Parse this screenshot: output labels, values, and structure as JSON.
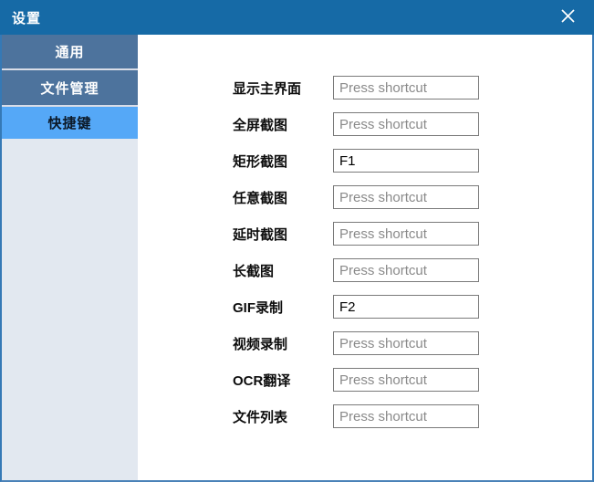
{
  "window": {
    "title": "设置",
    "close_icon": "x-close"
  },
  "sidebar": {
    "tabs": [
      {
        "label": "通用",
        "selected": false
      },
      {
        "label": "文件管理",
        "selected": false
      },
      {
        "label": "快捷键",
        "selected": true
      }
    ]
  },
  "shortcuts": {
    "placeholder": "Press shortcut",
    "rows": [
      {
        "label": "显示主界面",
        "value": ""
      },
      {
        "label": "全屏截图",
        "value": ""
      },
      {
        "label": "矩形截图",
        "value": "F1"
      },
      {
        "label": "任意截图",
        "value": ""
      },
      {
        "label": "延时截图",
        "value": ""
      },
      {
        "label": "长截图",
        "value": ""
      },
      {
        "label": "GIF录制",
        "value": "F2"
      },
      {
        "label": "视频录制",
        "value": ""
      },
      {
        "label": "OCR翻译",
        "value": ""
      },
      {
        "label": "文件列表",
        "value": ""
      }
    ]
  },
  "colors": {
    "titlebar_bg": "#166aa6",
    "tab_bg": "#4d739d",
    "tab_selected_bg": "#55a8f7",
    "sidebar_bg": "#e2e8f0",
    "window_border": "#3579b6",
    "input_border": "#7a7a7a",
    "placeholder_text": "#8a8a8a"
  }
}
